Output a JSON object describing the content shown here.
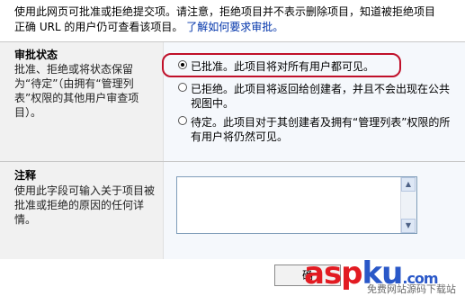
{
  "intro": {
    "line1": "使用此网页可批准或拒绝提交项。请注意，拒绝项目并不表示删除项目，知道被拒绝项目",
    "line2_prefix": "正确 URL 的用户仍可查看该项目。",
    "link": "了解如何要求审批。"
  },
  "approval": {
    "title": "审批状态",
    "description": "批准、拒绝或将状态保留为“待定”（由拥有“管理列表”权限的其他用户审查项目）。",
    "options": [
      {
        "label": "已批准。此项目将对所有用户都可见。",
        "selected": true
      },
      {
        "label": "已拒绝。此项目将返回给创建者，并且不会出现在公共视图中。",
        "selected": false
      },
      {
        "label": "待定。此项目对于其创建者及拥有“管理列表”权限的所有用户将仍然可见。",
        "selected": false
      }
    ]
  },
  "comments": {
    "title": "注释",
    "description": "使用此字段可输入关于项目被批准或拒绝的原因的任何详情。",
    "value": ""
  },
  "buttons": {
    "ok": "确"
  },
  "watermark": {
    "brand_red": "asp",
    "brand_blue": "ku",
    "brand_suffix": ".com",
    "tagline": "免费网站源码下载站"
  },
  "colors": {
    "highlight": "#c0102a",
    "link": "#0033aa"
  }
}
